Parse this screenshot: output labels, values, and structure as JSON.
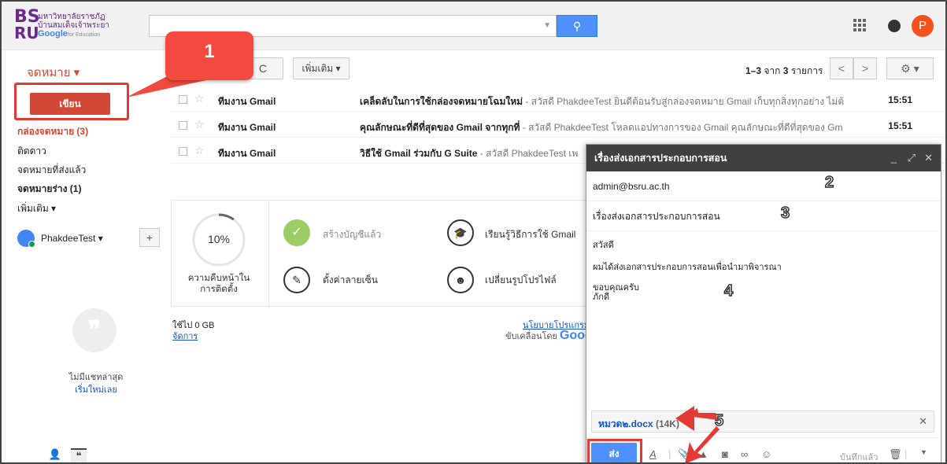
{
  "logo": {
    "mark1": "BS",
    "mark2": "RU",
    "line1": "มหาวิทยาลัยราชภัฏ",
    "line2": "บ้านสมเด็จเจ้าพระยา",
    "google": "Google",
    "edu": "for Education"
  },
  "header": {
    "avatar_letter": "P"
  },
  "toolbar": {
    "mail_label": "จดหมาย ▾",
    "refresh": "C",
    "more": "เพิ่มเติม ▾",
    "range": "1–3",
    "of_text": "จาก",
    "total": "3",
    "unit": "รายการ",
    "prev": "<",
    "next": ">"
  },
  "sidebar": {
    "compose": "เขียน",
    "items": [
      {
        "label": "กล่องจดหมาย (3)"
      },
      {
        "label": "ติดดาว"
      },
      {
        "label": "จดหมายที่ส่งแล้ว"
      },
      {
        "label": "จดหมายร่าง (1)"
      },
      {
        "label": "เพิ่มเติม ▾"
      }
    ],
    "user": "PhakdeeTest",
    "no_chat": "ไม่มีแชทล่าสุด",
    "new_chat": "เริ่มใหม่เลย"
  },
  "emails": [
    {
      "from": "ทีมงาน Gmail",
      "subject": "เคล็ดลับในการใช้กล่องจดหมายโฉมใหม่",
      "snippet": " - สวัสดี PhakdeeTest ยินดีต้อนรับสู่กล่องจดหมาย Gmail เก็บทุกสิ่งทุกอย่าง ไม่ต้",
      "time": "15:51"
    },
    {
      "from": "ทีมงาน Gmail",
      "subject": "คุณลักษณะที่ดีที่สุดของ Gmail จากทุกที่",
      "snippet": " - สวัสดี PhakdeeTest โหลดแอปทางการของ Gmail คุณลักษณะที่ดีที่สุดของ Gm",
      "time": "15:51"
    },
    {
      "from": "ทีมงาน Gmail",
      "subject": "วิธีใช้ Gmail ร่วมกับ G Suite",
      "snippet": " - สวัสดี PhakdeeTest เพ",
      "time": ""
    }
  ],
  "setup": {
    "progress": 10,
    "progress_text": "10%",
    "progress_label_1": "ความคืบหน้าใน",
    "progress_label_2": "การติดตั้ง",
    "create_account": "สร้างบัญชีแล้ว",
    "learn_gmail": "เรียนรู้วิธีการใช้ Gmail",
    "signature": "ตั้งค่าลายเซ็น",
    "profile_pic": "เปลี่ยนรูปโปรไฟล์"
  },
  "footer": {
    "storage": "ใช้ไป 0 GB",
    "manage": "จัดการ",
    "privacy": "นโยบายโปรแกรม",
    "powered": "ขับเคลื่อนโดย",
    "google_frag": "Goog"
  },
  "compose": {
    "title": "เรื่องส่งเอกสารประกอบการสอน",
    "to": "admin@bsru.ac.th",
    "subject": "เรื่องส่งเอกสารประกอบการสอน",
    "greeting": "สวัสดี",
    "body": "ผมได้ส่งเอกสารประกอบการสอนเพื่อนำมาพิจารณา",
    "thanks": "ขอบคุณครับ",
    "name": "ภักดี",
    "attachment_name": "หมวด๒.docx",
    "attachment_size": "(14K)",
    "send": "ส่ง",
    "saved": "บันทึกแล้ว"
  },
  "callouts": {
    "c1": "1",
    "c2": "2",
    "c3": "3",
    "c4": "4",
    "c5": "5"
  },
  "colors": {
    "accent_red": "#d14836",
    "blue": "#4d90fe",
    "callout": "#f24a3f"
  }
}
